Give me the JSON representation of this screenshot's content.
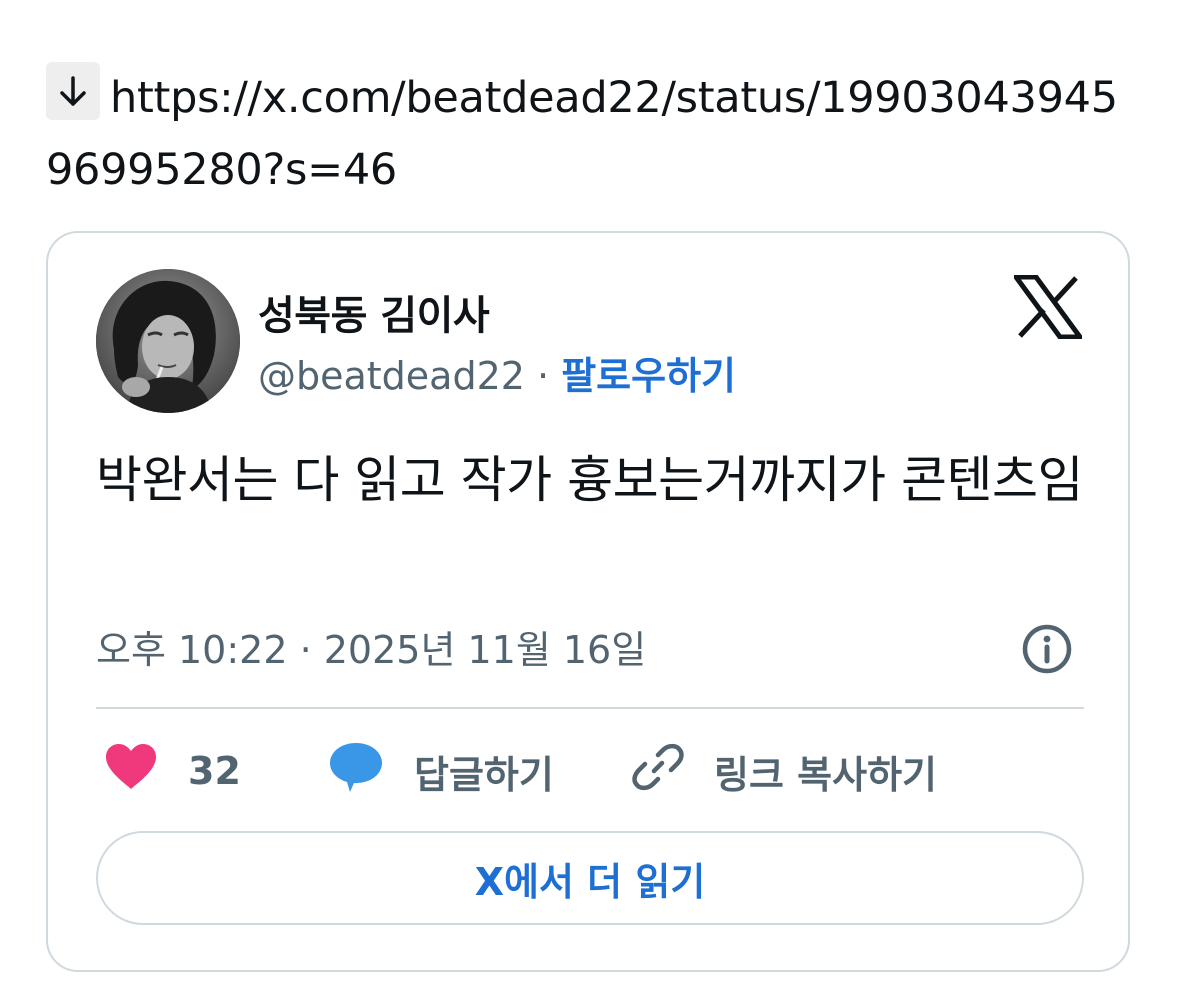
{
  "link": {
    "icon": "down-arrow-icon",
    "url": "https://x.com/beatdead22/status/1990304394596995280?s=46"
  },
  "tweet": {
    "display_name": "성북동 김이사",
    "handle": "@beatdead22",
    "separator": " · ",
    "follow_label": "팔로우하기",
    "text": "박완서는 다 읽고 작가 흉보는거까지가 콘텐츠임",
    "timestamp": "오후 10:22 · 2025년 11월 16일",
    "likes": "32",
    "reply_label": "답글하기",
    "copy_link_label": "링크 복사하기",
    "read_more_label": "X에서 더 읽기"
  },
  "icons": {
    "logo": "x-logo-icon",
    "info": "info-icon",
    "like": "heart-icon",
    "reply": "speech-bubble-icon",
    "copy": "link-icon"
  },
  "colors": {
    "follow_link": "#1d6fd4",
    "heart": "#f91880",
    "reply_bubble": "#1d9bf0",
    "secondary_text": "#536471",
    "border": "#cfd9de"
  }
}
